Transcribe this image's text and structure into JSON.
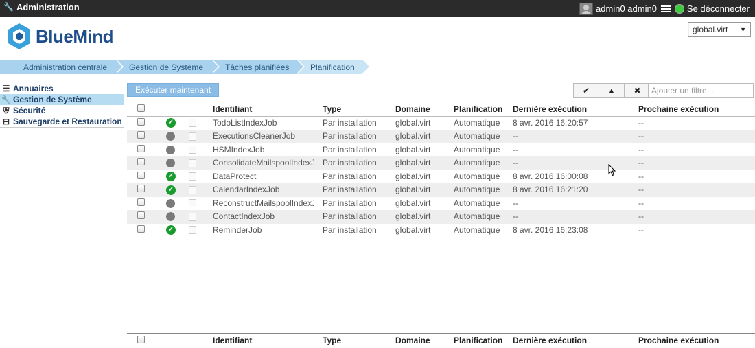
{
  "topbar": {
    "app_title": "Administration",
    "user_name": "admin0 admin0",
    "logout_label": "Se déconnecter",
    "status_color": "#3dcc3d"
  },
  "header": {
    "logo_text": "BlueMind",
    "domain_selected": "global.virt"
  },
  "breadcrumb": [
    "Administration centrale",
    "Gestion de Système",
    "Tâches planifiées",
    "Planification"
  ],
  "sidebar": {
    "items": [
      {
        "label": "Annuaires",
        "icon": "list-icon",
        "active": false
      },
      {
        "label": "Gestion de Système",
        "icon": "wrench-icon",
        "active": true
      },
      {
        "label": "Sécurité",
        "icon": "shield-icon",
        "active": false
      },
      {
        "label": "Sauvegarde et Restauration",
        "icon": "drive-icon",
        "active": false
      }
    ]
  },
  "toolbar": {
    "run_now_label": "Exécuter maintenant",
    "filter_placeholder": "Ajouter un filtre..."
  },
  "table": {
    "columns": [
      "Identifiant",
      "Type",
      "Domaine",
      "Planification",
      "Dernière exécution",
      "Prochaine exécution"
    ],
    "rows": [
      {
        "status": "success",
        "id": "TodoListIndexJob",
        "type": "Par installation",
        "domain": "global.virt",
        "plan": "Automatique",
        "last": "8 avr. 2016 16:20:57",
        "next": "--"
      },
      {
        "status": "idle",
        "id": "ExecutionsCleanerJob",
        "type": "Par installation",
        "domain": "global.virt",
        "plan": "Automatique",
        "last": "--",
        "next": "--"
      },
      {
        "status": "idle",
        "id": "HSMIndexJob",
        "type": "Par installation",
        "domain": "global.virt",
        "plan": "Automatique",
        "last": "--",
        "next": "--"
      },
      {
        "status": "idle",
        "id": "ConsolidateMailspoolIndexJob",
        "type": "Par installation",
        "domain": "global.virt",
        "plan": "Automatique",
        "last": "--",
        "next": "--"
      },
      {
        "status": "success",
        "id": "DataProtect",
        "type": "Par installation",
        "domain": "global.virt",
        "plan": "Automatique",
        "last": "8 avr. 2016 16:00:08",
        "next": "--"
      },
      {
        "status": "success",
        "id": "CalendarIndexJob",
        "type": "Par installation",
        "domain": "global.virt",
        "plan": "Automatique",
        "last": "8 avr. 2016 16:21:20",
        "next": "--"
      },
      {
        "status": "idle",
        "id": "ReconstructMailspoolIndexJob",
        "type": "Par installation",
        "domain": "global.virt",
        "plan": "Automatique",
        "last": "--",
        "next": "--"
      },
      {
        "status": "idle",
        "id": "ContactIndexJob",
        "type": "Par installation",
        "domain": "global.virt",
        "plan": "Automatique",
        "last": "--",
        "next": "--"
      },
      {
        "status": "success",
        "id": "ReminderJob",
        "type": "Par installation",
        "domain": "global.virt",
        "plan": "Automatique",
        "last": "8 avr. 2016 16:23:08",
        "next": "--"
      }
    ]
  }
}
